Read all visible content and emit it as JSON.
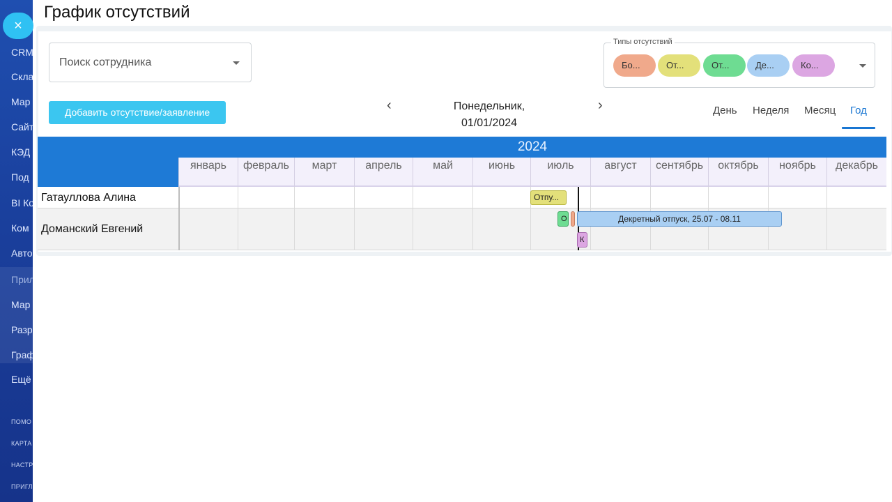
{
  "sidebar": {
    "items": [
      "CRM",
      "Скла",
      "Мар",
      "Сайт",
      "КЭД",
      "Под",
      "BI Ко",
      "Ком",
      "Авто",
      "Прил",
      "Мар",
      "Разр",
      "Граф",
      "Ещё"
    ],
    "small_items": [
      "ПОМО",
      "КАРТА",
      "НАСТР",
      "ПРИГЛ"
    ]
  },
  "close_icon_glyph": "×",
  "page_title": "График отсутствий",
  "search": {
    "placeholder": "Поиск сотрудника"
  },
  "add_button_label": "Добавить отсутствие/заявление",
  "absence_types": {
    "legend": "Типы отсутствий",
    "chips": [
      {
        "label": "Бо...",
        "color": "#f0a98b"
      },
      {
        "label": "От...",
        "color": "#e3e07a"
      },
      {
        "label": "От...",
        "color": "#6edc92"
      },
      {
        "label": "Де...",
        "color": "#a9cff3"
      },
      {
        "label": "Ко...",
        "color": "#dca6e2"
      }
    ]
  },
  "navigation": {
    "prev_glyph": "‹",
    "next_glyph": "›",
    "date_weekday": "Понедельник,",
    "date_value": "01/01/2024"
  },
  "views": [
    {
      "label": "День",
      "active": false
    },
    {
      "label": "Неделя",
      "active": false
    },
    {
      "label": "Месяц",
      "active": false
    },
    {
      "label": "Год",
      "active": true
    }
  ],
  "calendar": {
    "year": "2024",
    "months": [
      "январь",
      "февраль",
      "март",
      "апрель",
      "май",
      "июнь",
      "июль",
      "август",
      "сентябрь",
      "октябрь",
      "ноябрь",
      "декабрь"
    ]
  },
  "employees": [
    {
      "name": "Гатауллова Алина",
      "absences": [
        {
          "label": "Отпу...",
          "color": "#e3e07a"
        }
      ]
    },
    {
      "name": "Доманский Евгений",
      "absences": [
        {
          "label": "О",
          "color": "#6edc92"
        },
        {
          "label": "",
          "color": "#f0a98b"
        },
        {
          "label": "Декретный отпуск, 25.07 - 08.11",
          "color": "#a9cff3"
        },
        {
          "label": "К",
          "color": "#dca6e2"
        }
      ]
    }
  ]
}
